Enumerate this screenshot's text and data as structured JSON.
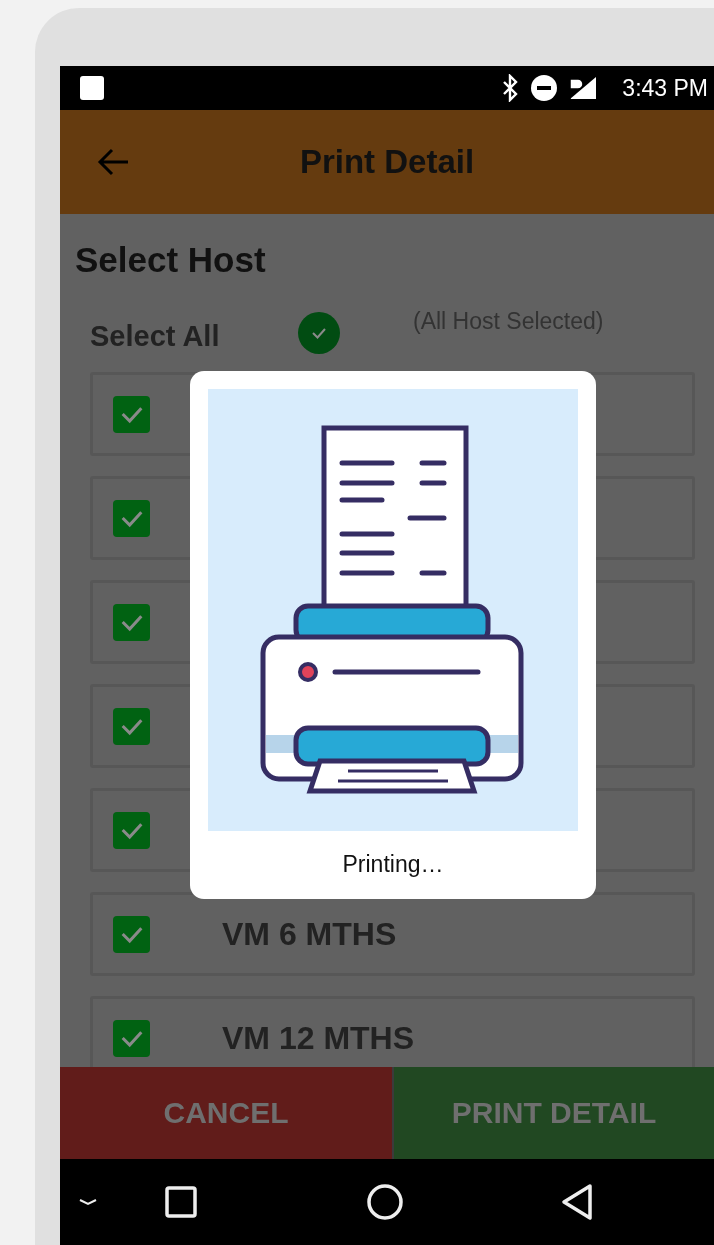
{
  "status_bar": {
    "time": "3:43 PM"
  },
  "app_bar": {
    "title": "Print Detail"
  },
  "section_title": "Select Host",
  "select_all": {
    "label": "Select All",
    "checked": true,
    "note": "(All Host Selected)"
  },
  "hosts": [
    {
      "checked": true
    },
    {
      "checked": true
    },
    {
      "checked": true
    },
    {
      "checked": true
    },
    {
      "checked": true
    },
    {
      "label": "VM 6 MTHS",
      "checked": true
    },
    {
      "label": "VM 12 MTHS",
      "checked": true
    }
  ],
  "dialog": {
    "message": "Printing…"
  },
  "buttons": [
    {
      "label": "CANCEL",
      "kind": "cancel"
    },
    {
      "label": "PRINT DETAIL",
      "kind": "confirm"
    }
  ]
}
